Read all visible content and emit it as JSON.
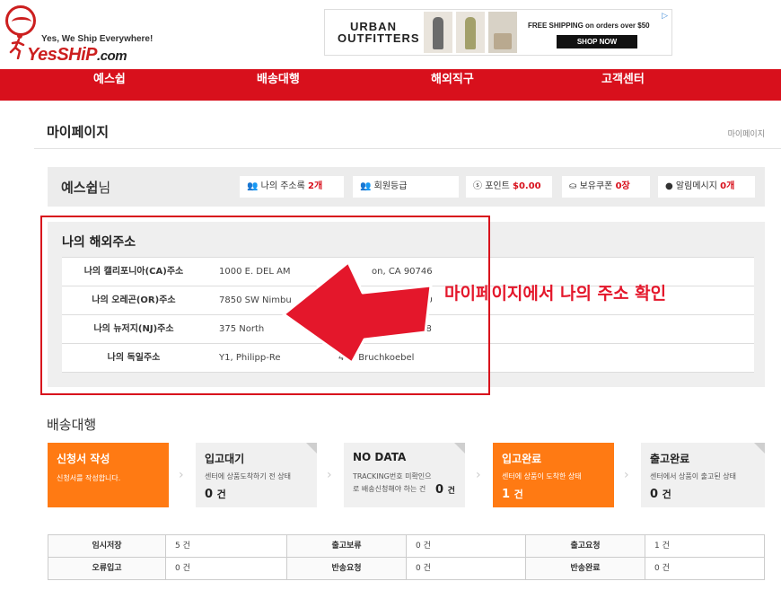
{
  "header": {
    "logo_tagline": "Yes, We Ship Everywhere!",
    "logo_word": "YesSHiP",
    "logo_domain": ".com",
    "ad": {
      "brand": "URBAN OUTFITTERS",
      "text": "FREE SHIPPING on orders over $50",
      "button": "SHOP NOW"
    }
  },
  "nav": [
    "예스쉽",
    "배송대행",
    "해외직구",
    "고객센터"
  ],
  "page": {
    "title": "마이페이지",
    "breadcrumb": "마이페이지"
  },
  "user": {
    "name": "예스쉽",
    "suffix": "님",
    "address_book_label": "나의 주소록",
    "address_book_value": "2개",
    "grade_label": "회원등급",
    "points_label": "포인트",
    "points_value": "$0.00",
    "coupon_label": "보유쿠폰",
    "coupon_value": "0장",
    "messages_label": "알림메시지",
    "messages_value": "0개"
  },
  "addresses": {
    "title": "나의 해외주소",
    "rows": [
      {
        "label": "나의 캘리포니아(CA)주소",
        "value": "1000 E. DEL AM",
        "value2": "on, CA   90746"
      },
      {
        "label": "나의 오레곤(OR)주소",
        "value": "7850 SW Nimbu",
        "value2": "70"
      },
      {
        "label": "나의 뉴저지(NJ)주소",
        "value": "375 North",
        "value2": "07608"
      },
      {
        "label": "나의 독일주소",
        "value": "Y1, Philipp-Re",
        "value2": "486 Bruchkoebel"
      }
    ],
    "callout": "마이페이지에서 나의 주소 확인"
  },
  "shipping": {
    "title": "배송대행",
    "stages": [
      {
        "title": "신청서 작성",
        "desc": "신청서를 작성합니다.",
        "count": "",
        "unit": "",
        "highlight": true
      },
      {
        "title": "입고대기",
        "desc": "센터에 상품도착하기 전 상태",
        "count": "0",
        "unit": "건",
        "highlight": false
      },
      {
        "title": "NO DATA",
        "desc": "TRACKING번호 미확인으로 배송신청해야 하는 건",
        "count": "0",
        "unit": "건",
        "highlight": false
      },
      {
        "title": "입고완료",
        "desc": "센터에 상품이 도착한 상태",
        "count": "1",
        "unit": "건",
        "highlight": true
      },
      {
        "title": "출고완료",
        "desc": "센터에서 상품이 출고된 상태",
        "count": "0",
        "unit": "건",
        "highlight": false
      }
    ],
    "summary": [
      [
        {
          "k": "임시저장",
          "v": "5 건"
        },
        {
          "k": "출고보류",
          "v": "0 건"
        },
        {
          "k": "출고요청",
          "v": "1 건"
        }
      ],
      [
        {
          "k": "오류입고",
          "v": "0 건"
        },
        {
          "k": "반송요청",
          "v": "0 건"
        },
        {
          "k": "반송완료",
          "v": "0 건"
        }
      ]
    ]
  },
  "colors": {
    "brand_red": "#d8101c",
    "orange": "#ff7a13",
    "callout_red": "#e4172b"
  }
}
